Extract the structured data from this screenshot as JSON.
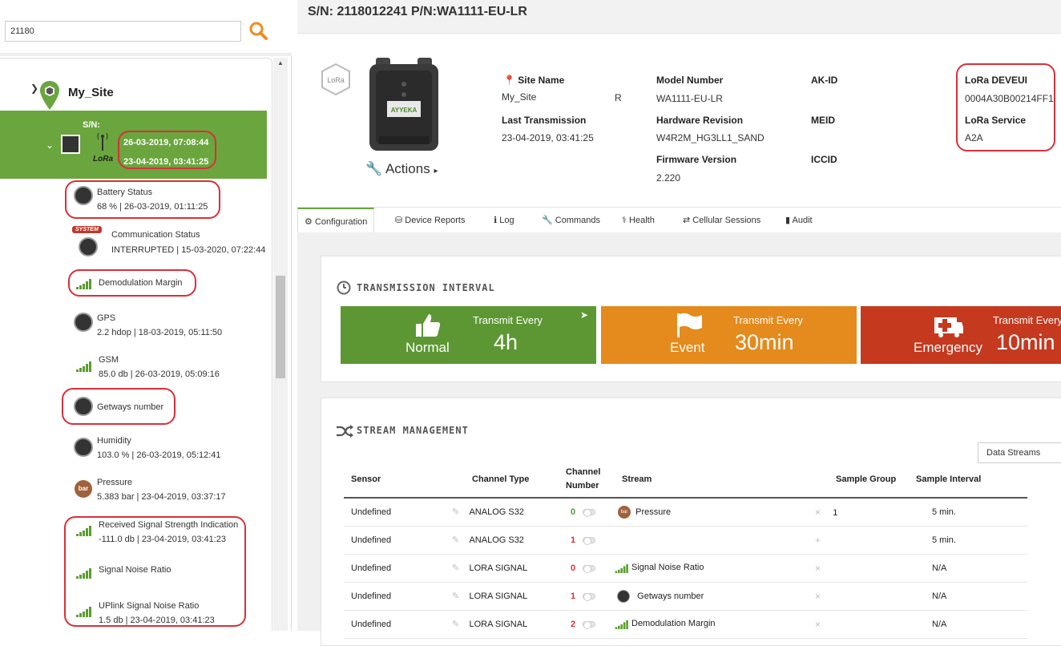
{
  "search": {
    "value": "21180"
  },
  "tree": {
    "site_name": "My_Site",
    "device": {
      "sn_label": "S/N:",
      "lora_label": "LoRa",
      "date1": "26-03-2019, 07:08:44",
      "date2": "23-04-2019, 03:41:25"
    },
    "sensors": [
      {
        "name": "Battery Status",
        "value": "68 % | 26-03-2019, 01:11:25"
      },
      {
        "badge": "SYSTEM",
        "name": "Communication Status",
        "value": "INTERRUPTED | 15-03-2020, 07:22:44"
      },
      {
        "name": "Demodulation Margin",
        "value": ""
      },
      {
        "name": "GPS",
        "value": "2.2 hdop | 18-03-2019, 05:11:50"
      },
      {
        "name": "GSM",
        "value": "85.0 db | 26-03-2019, 05:09:16"
      },
      {
        "name": "Getways number",
        "value": ""
      },
      {
        "name": "Humidity",
        "value": "103.0 % | 26-03-2019, 05:12:41"
      },
      {
        "icon_text": "bar",
        "name": "Pressure",
        "value": "5.383 bar | 23-04-2019, 03:37:17"
      },
      {
        "name": "Received Signal Strength Indication",
        "value": "-111.0 db | 23-04-2019, 03:41:23"
      },
      {
        "name": "Signal Noise Ratio",
        "value": ""
      },
      {
        "name": "UPlink Signal Noise Ratio",
        "value": "1.5 db | 23-04-2019, 03:41:23"
      }
    ]
  },
  "header": {
    "title": "S/N: 2118012241 P/N:WA1111-EU-LR"
  },
  "device_info": {
    "lora_icon": "LoRa",
    "device_label": "AYYEKA",
    "actions": "Actions",
    "site_name_label": "Site Name",
    "site_name": "My_Site",
    "site_name_suffix": "R",
    "last_transmission_label": "Last Transmission",
    "last_transmission": "23-04-2019, 03:41:25",
    "model_number_label": "Model Number",
    "model_number": "WA1111-EU-LR",
    "hardware_revision_label": "Hardware Revision",
    "hardware_revision": "W4R2M_HG3LL1_SAND",
    "firmware_version_label": "Firmware Version",
    "firmware_version": "2.220",
    "akid_label": "AK-ID",
    "meid_label": "MEID",
    "iccid_label": "ICCID",
    "lora_deveui_label": "LoRa DEVEUI",
    "lora_deveui": "0004A30B00214FF1",
    "lora_service_label": "LoRa Service",
    "lora_service": "A2A"
  },
  "tabs": [
    {
      "label": "Configuration",
      "icon": "gears-icon"
    },
    {
      "label": "Device Reports",
      "icon": "chart-icon"
    },
    {
      "label": "Log",
      "icon": "info-icon"
    },
    {
      "label": "Commands",
      "icon": "wrench-icon"
    },
    {
      "label": "Health",
      "icon": "stethoscope-icon"
    },
    {
      "label": "Cellular Sessions",
      "icon": "exchange-icon"
    },
    {
      "label": "Audit",
      "icon": "book-icon"
    }
  ],
  "transmission": {
    "title": "TRANSMISSION INTERVAL",
    "cards": [
      {
        "name": "Normal",
        "label": "Transmit Every",
        "value": "4h",
        "color": "#5d9733"
      },
      {
        "name": "Event",
        "label": "Transmit Every",
        "value": "30min",
        "color": "#e58a1c"
      },
      {
        "name": "Emergency",
        "label": "Transmit Every",
        "value": "10min",
        "color": "#c5391f"
      }
    ]
  },
  "streams": {
    "title": "STREAM MANAGEMENT",
    "dropdown": "Data Streams",
    "columns": [
      "Sensor",
      "Channel Type",
      "Channel Number",
      "Stream",
      "Sample Group",
      "Sample Interval"
    ],
    "rows": [
      {
        "sensor": "Undefined",
        "type": "ANALOG S32",
        "channel": "0",
        "stream": "Pressure",
        "stream_icon": "bar",
        "group": "1",
        "interval": "5 min.",
        "action": "×"
      },
      {
        "sensor": "Undefined",
        "type": "ANALOG S32",
        "channel": "1",
        "stream": "",
        "stream_icon": "",
        "group": "",
        "interval": "5 min.",
        "action": "+"
      },
      {
        "sensor": "Undefined",
        "type": "LORA SIGNAL",
        "channel": "0",
        "stream": "Signal Noise Ratio",
        "stream_icon": "signal",
        "group": "",
        "interval": "N/A",
        "action": "×"
      },
      {
        "sensor": "Undefined",
        "type": "LORA SIGNAL",
        "channel": "1",
        "stream": "Getways number",
        "stream_icon": "gauge",
        "group": "",
        "interval": "N/A",
        "action": "×"
      },
      {
        "sensor": "Undefined",
        "type": "LORA SIGNAL",
        "channel": "2",
        "stream": "Demodulation Margin",
        "stream_icon": "signal",
        "group": "",
        "interval": "N/A",
        "action": "×"
      }
    ]
  },
  "colors": {
    "accent_green": "#6aa53e",
    "highlight_red": "#d9303a",
    "search_orange": "#f08c1a"
  }
}
